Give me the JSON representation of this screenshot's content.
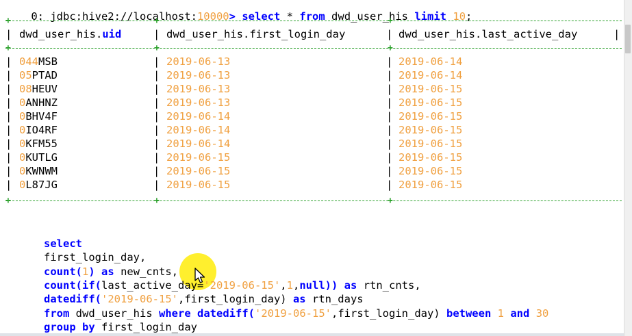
{
  "top_line": {
    "prefix": "0: jdbc:hive2://localhost:",
    "port": "10000",
    "prompt": ">",
    "kw_select": "select",
    "star": "*",
    "kw_from": "from",
    "table": "dwd_user_his",
    "kw_limit": "limit",
    "limit_value": "10",
    "terminator": ";"
  },
  "table": {
    "headers": [
      {
        "prefix": "dwd_user_his.",
        "name": "uid"
      },
      {
        "prefix": "dwd_user_his.",
        "name": "first_login_day"
      },
      {
        "prefix": "dwd_user_his.",
        "name": "last_active_day"
      }
    ],
    "rows": [
      {
        "uid_digits": "044",
        "uid_letters": "MSB",
        "first_login_day": "2019-06-13",
        "last_active_day": "2019-06-14"
      },
      {
        "uid_digits": "05",
        "uid_letters": "PTAD",
        "first_login_day": "2019-06-13",
        "last_active_day": "2019-06-14"
      },
      {
        "uid_digits": "08",
        "uid_letters": "HEUV",
        "first_login_day": "2019-06-13",
        "last_active_day": "2019-06-15"
      },
      {
        "uid_digits": "0",
        "uid_letters": "ANHNZ",
        "first_login_day": "2019-06-13",
        "last_active_day": "2019-06-15"
      },
      {
        "uid_digits": "0",
        "uid_letters": "BHV4F",
        "first_login_day": "2019-06-14",
        "last_active_day": "2019-06-15"
      },
      {
        "uid_digits": "0",
        "uid_letters": "IO4RF",
        "first_login_day": "2019-06-14",
        "last_active_day": "2019-06-15"
      },
      {
        "uid_digits": "0",
        "uid_letters": "KFM55",
        "first_login_day": "2019-06-14",
        "last_active_day": "2019-06-15"
      },
      {
        "uid_digits": "0",
        "uid_letters": "KUTLG",
        "first_login_day": "2019-06-15",
        "last_active_day": "2019-06-15"
      },
      {
        "uid_digits": "0",
        "uid_letters": "KWNWM",
        "first_login_day": "2019-06-15",
        "last_active_day": "2019-06-15"
      },
      {
        "uid_digits": "0",
        "uid_letters": "L87JG",
        "first_login_day": "2019-06-15",
        "last_active_day": "2019-06-15"
      }
    ]
  },
  "query": {
    "l1_select": "select",
    "l2_field": "first_login_day,",
    "l3_count": "count",
    "l3_open": "(",
    "l3_one": "1",
    "l3_close": ")",
    "l3_as": "as",
    "l3_alias": "new_cnts,",
    "l4_count_if": "count(if(",
    "l4_field": "last_active_day=",
    "l4_date": "'2019-06-15'",
    "l4_comma1": ",",
    "l4_one": "1",
    "l4_comma2": ",",
    "l4_null": "null",
    "l4_close": "))",
    "l4_as": "as",
    "l4_alias": "rtn_cnts,",
    "l5_datediff": "datediff(",
    "l5_date": "'2019-06-15'",
    "l5_rest": ",first_login_day)",
    "l5_as": "as",
    "l5_alias": "rtn_days",
    "l6_from": "from",
    "l6_table": "dwd_user_his",
    "l6_where": "where",
    "l6_datediff": "datediff(",
    "l6_date": "'2019-06-15'",
    "l6_rest": ",first_login_day)",
    "l6_between": "between",
    "l6_low": "1",
    "l6_and": "and",
    "l6_high": "30",
    "l7_group_by": "group by",
    "l7_field": "first_login_day",
    "l8_terminator": ";"
  },
  "colors": {
    "keyword": "#0000ff",
    "literal": "#f0a040",
    "border": "#2aa02a",
    "cursor_highlight": "#ffec00"
  },
  "icons": [
    "mouse-cursor-icon",
    "scrollbar-thumb"
  ]
}
